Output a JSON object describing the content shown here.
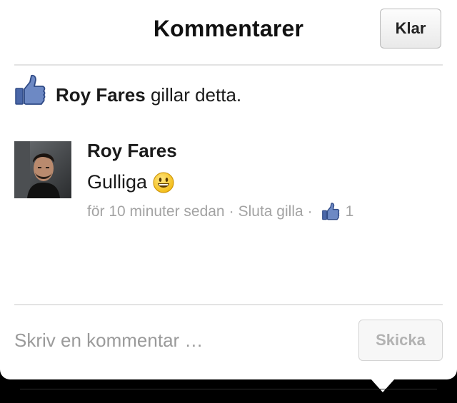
{
  "header": {
    "title": "Kommentarer",
    "done_label": "Klar"
  },
  "likes": {
    "icon": "thumbs-up-icon",
    "name": "Roy Fares",
    "text": " gillar detta."
  },
  "comment": {
    "author": "Roy Fares",
    "text": "Gulliga",
    "emoji": "smiley-emoji",
    "time": "för 10 minuter sedan",
    "separator": "·",
    "unlike_label": "Sluta gilla",
    "like_count": "1"
  },
  "composer": {
    "placeholder": "Skriv en kommentar …",
    "send_label": "Skicka"
  },
  "colors": {
    "facebook_blue": "#3b5998",
    "meta_gray": "#a3a3a3",
    "emoji_yellow": "#f7c51a"
  }
}
